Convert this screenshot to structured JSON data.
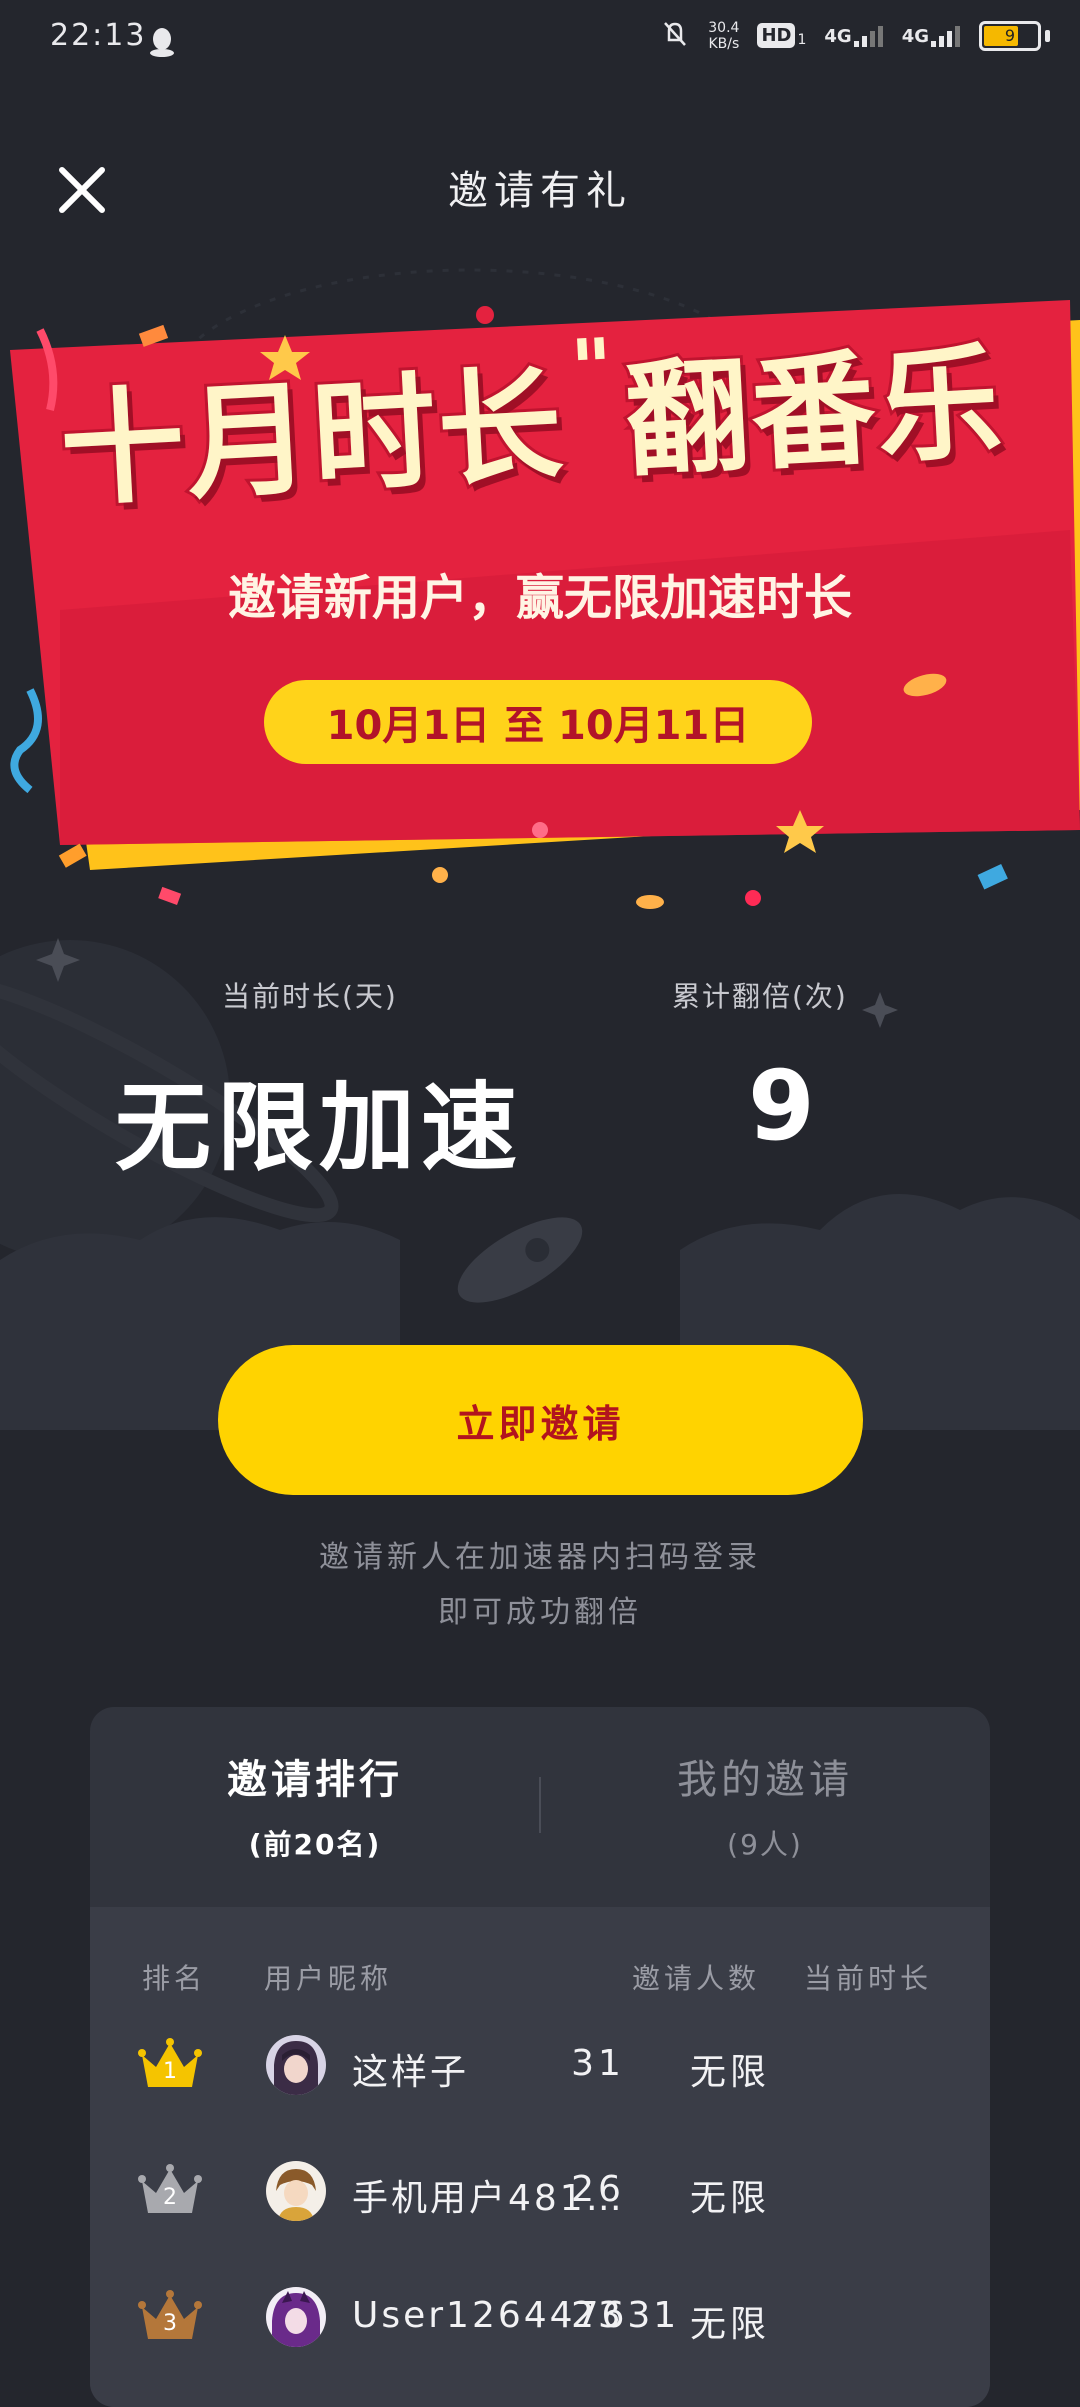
{
  "status_bar": {
    "time": "22:13",
    "net_speed_value": "30.4",
    "net_speed_unit": "KB/s",
    "hd": "HD",
    "hd_sub": "1",
    "sig1": "4G",
    "sig2": "4G",
    "battery": "9"
  },
  "header": {
    "title": "邀请有礼"
  },
  "banner": {
    "headline_1": "十月时长",
    "headline_2": "翻番乐",
    "subtitle": "邀请新用户，赢无限加速时长",
    "dates": "10月1日 至 10月11日"
  },
  "stats": {
    "current_label": "当前时长(天)",
    "current_value": "无限加速",
    "multiplier_label": "累计翻倍(次)",
    "multiplier_value": "9"
  },
  "invite": {
    "button_label": "立即邀请",
    "hint_line1": "邀请新人在加速器内扫码登录",
    "hint_line2": "即可成功翻倍"
  },
  "ranking": {
    "tab_rank_title": "邀请排行",
    "tab_rank_sub": "(前20名)",
    "tab_mine_title": "我的邀请",
    "tab_mine_sub": "(9人)",
    "columns": {
      "rank": "排名",
      "nickname": "用户昵称",
      "invites": "邀请人数",
      "duration": "当前时长"
    },
    "rows": [
      {
        "rank": "1",
        "nickname": "这样子",
        "invites": "31",
        "duration": "无限"
      },
      {
        "rank": "2",
        "nickname": "手机用户481…",
        "invites": "26",
        "duration": "无限"
      },
      {
        "rank": "3",
        "nickname": "User126447631",
        "invites": "23",
        "duration": "无限"
      }
    ]
  },
  "colors": {
    "bg": "#24262d",
    "accent_yellow": "#ffd300",
    "banner_red": "#e4223f",
    "text_red": "#b2141e",
    "gold": "#f5c400",
    "silver": "#a8a9ae",
    "bronze": "#b4773a"
  },
  "icons": [
    "close-icon",
    "qq-icon",
    "mute-icon",
    "crown-icon"
  ]
}
